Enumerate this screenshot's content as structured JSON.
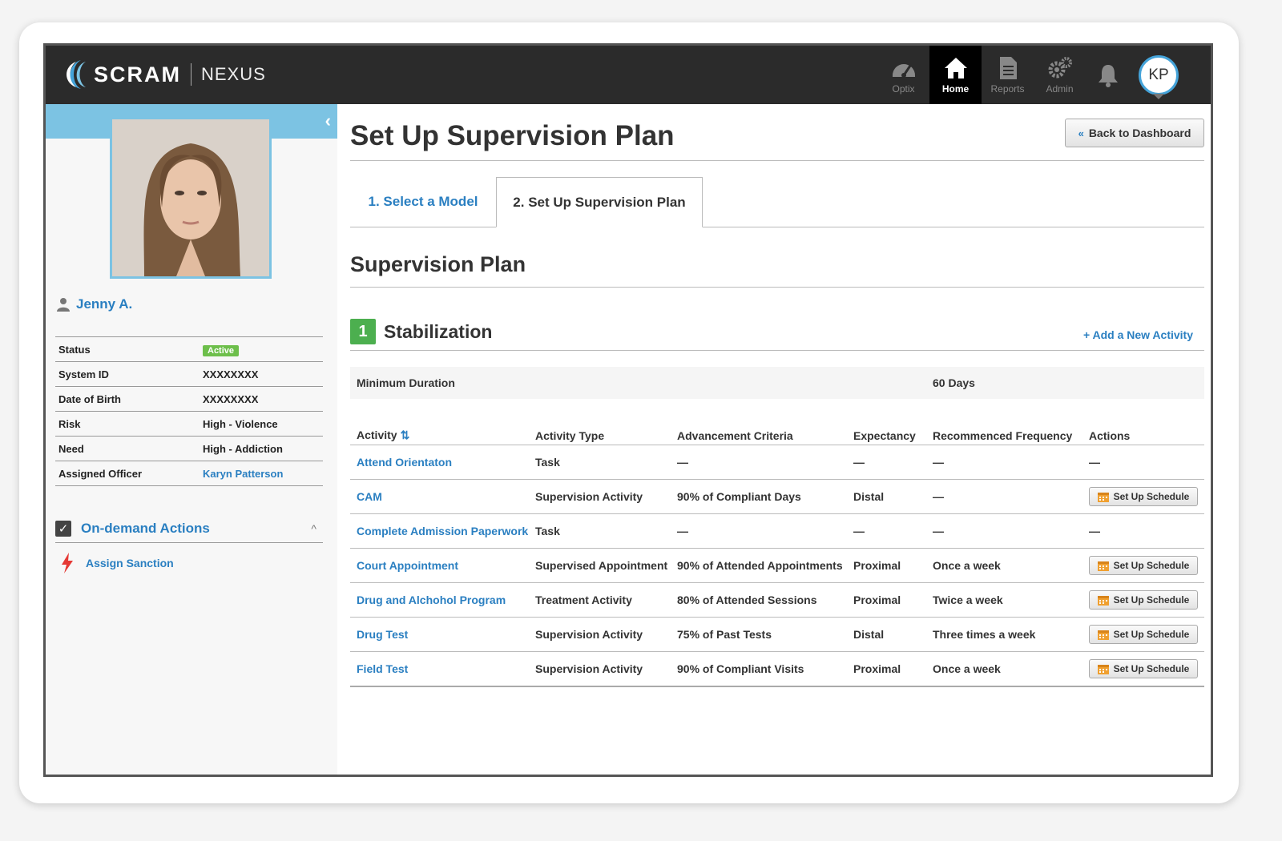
{
  "app": {
    "brand": "SCRAM",
    "product": "NEXUS",
    "nav": [
      {
        "label": "Optix",
        "icon": "speedometer-icon"
      },
      {
        "label": "Home",
        "icon": "home-icon",
        "active": true
      },
      {
        "label": "Reports",
        "icon": "document-icon"
      },
      {
        "label": "Admin",
        "icon": "gears-icon"
      }
    ],
    "user_initials": "KP"
  },
  "client": {
    "name": "Jenny A.",
    "details": [
      {
        "label": "Status",
        "value": "Active"
      },
      {
        "label": "System ID",
        "value": "XXXXXXXX"
      },
      {
        "label": "Date of Birth",
        "value": "XXXXXXXX"
      },
      {
        "label": "Risk",
        "value": "High - Violence"
      },
      {
        "label": "Need",
        "value": "High - Addiction"
      },
      {
        "label": "Assigned Officer",
        "value": "Karyn Patterson"
      }
    ]
  },
  "ondemand": {
    "title": "On-demand Actions",
    "action": "Assign Sanction"
  },
  "page": {
    "title": "Set Up Supervision Plan",
    "back_label": "Back to Dashboard",
    "tabs": [
      "1. Select a Model",
      "2. Set Up Supervision Plan"
    ],
    "section_title": "Supervision Plan"
  },
  "phase": {
    "number": "1",
    "title": "Stabilization",
    "add_label": "+ Add a New Activity",
    "min_duration_label": "Minimum Duration",
    "min_duration_value": "60 Days"
  },
  "table": {
    "headers": [
      "Activity",
      "Activity Type",
      "Advancement Criteria",
      "Expectancy",
      "Recommenced Frequency",
      "Actions"
    ],
    "schedule_label": "Set Up Schedule",
    "rows": [
      {
        "activity": "Attend Orientaton",
        "type": "Task",
        "criteria": "—",
        "expectancy": "—",
        "frequency": "—",
        "action": "—"
      },
      {
        "activity": "CAM",
        "type": "Supervision Activity",
        "criteria": "90% of Compliant Days",
        "expectancy": "Distal",
        "frequency": "—",
        "action": "Set Up Schedule"
      },
      {
        "activity": "Complete Admission Paperwork",
        "type": "Task",
        "criteria": "—",
        "expectancy": "—",
        "frequency": "—",
        "action": "—"
      },
      {
        "activity": "Court Appointment",
        "type": "Supervised Appointment",
        "criteria": "90% of Attended Appointments",
        "expectancy": "Proximal",
        "frequency": "Once a week",
        "action": "Set Up Schedule"
      },
      {
        "activity": "Drug and Alchohol Program",
        "type": "Treatment Activity",
        "criteria": "80% of Attended Sessions",
        "expectancy": "Proximal",
        "frequency": "Twice a week",
        "action": "Set Up Schedule"
      },
      {
        "activity": "Drug Test",
        "type": "Supervision Activity",
        "criteria": "75% of Past Tests",
        "expectancy": "Distal",
        "frequency": "Three times a week",
        "action": "Set Up Schedule"
      },
      {
        "activity": "Field Test",
        "type": "Supervision Activity",
        "criteria": "90% of Compliant Visits",
        "expectancy": "Proximal",
        "frequency": "Once a week",
        "action": "Set Up Schedule"
      }
    ]
  },
  "colors": {
    "topbar": "#2b2b2b",
    "accent": "#2a7fc1",
    "sidebar_band": "#7cc3e3",
    "active_badge": "#6dbf4b",
    "phase_badge": "#4caf4f"
  }
}
